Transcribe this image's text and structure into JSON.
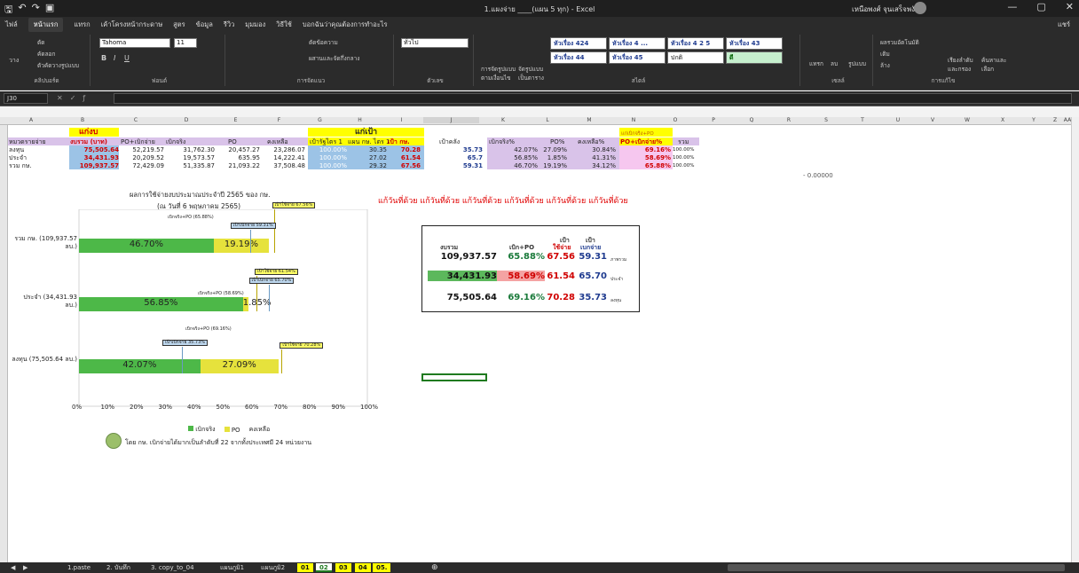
{
  "window": {
    "title": "1.แผงจ่าย ____(แผน 5 ทุก) - Excel",
    "user": "เหนือพงศ์ จุนเสร็จพงันธ์",
    "min": "—",
    "max": "▢",
    "close": "✕"
  },
  "menu": [
    "ไฟล์",
    "หน้าแรก",
    "แทรก",
    "เค้าโครงหน้ากระดาษ",
    "สูตร",
    "ข้อมูล",
    "รีวิว",
    "มุมมอง",
    "วิธีใช้",
    "บอกฉันว่าคุณต้องการทำอะไร"
  ],
  "share": "แชร์",
  "ribbon": {
    "clipboard": {
      "label": "คลิปบอร์ด",
      "paste": "วาง",
      "cut": "ตัด",
      "copy": "คัดลอก",
      "format": "ตัวคัดวางรูปแบบ"
    },
    "font": {
      "label": "ฟอนต์",
      "name": "Tahoma",
      "size": "11",
      "bold": "B",
      "italic": "I",
      "underline": "U"
    },
    "alignment": {
      "label": "การจัดแนว",
      "wrap": "ตัดข้อความ",
      "merge": "ผสานและจัดกึ่งกลาง"
    },
    "number": {
      "label": "ตัวเลข",
      "format": "ทั่วไป"
    },
    "styles": {
      "label": "สไตล์",
      "cond": "การจัดรูปแบบตามเงื่อนไข",
      "table": "จัดรูปแบบเป็นตาราง",
      "items": [
        "หัวเรื่อง 424",
        "หัวเรื่อง 4 ...",
        "หัวเรื่อง 4 2 5",
        "หัวเรื่อง 43",
        "หัวเรื่อง 44",
        "หัวเรื่อง 45",
        "ปกติ",
        "ดี"
      ]
    },
    "cells": {
      "label": "เซลล์",
      "insert": "แทรก",
      "delete": "ลบ",
      "format": "รูปแบบ"
    },
    "editing": {
      "label": "การแก้ไข",
      "autosum": "ผลรวมอัตโนมัติ",
      "fill": "เติม",
      "clear": "ล้าง",
      "sort": "เรียงลำดับและกรอง",
      "find": "ค้นหาและเลือก"
    }
  },
  "formula": {
    "namebox": "J30",
    "content": ""
  },
  "columns": [
    "A",
    "B",
    "C",
    "D",
    "E",
    "F",
    "G",
    "H",
    "I",
    "J",
    "K",
    "L",
    "M",
    "N",
    "O",
    "P",
    "Q",
    "R",
    "S",
    "T",
    "U",
    "V",
    "W",
    "X",
    "Y",
    "Z",
    "AA"
  ],
  "table": {
    "band_budget": "แก่งบ",
    "band_target": "แก่เป้า",
    "n_header": "แก่เบิกจริง+PO",
    "headers": [
      "หมวดรายจ่าย",
      "งบรวม (บาท)",
      "PO+เบิกจ่าย",
      "เบิกจริง",
      "PO",
      "คงเหลือ",
      "เป้ารัฐไตร 1",
      "แผน กษ. ไตร 1",
      "เป้า กษ.",
      "เป้าคลัง",
      "เบิกจริง%",
      "PO%",
      "คงเหลือ%",
      "PO+เบิกจ่าย%",
      "รวม"
    ],
    "rows": [
      {
        "name": "ลงทุน",
        "budget": "75,505.64",
        "po_paid": "52,219.57",
        "paid": "31,762.30",
        "po": "20,457.27",
        "remain": "23,286.07",
        "t1": "100.00%",
        "t2": "30.35",
        "t3": "70.28",
        "t4": "35.73",
        "p1": "42.07%",
        "p2": "27.09%",
        "p3": "30.84%",
        "p4": "69.16%",
        "tot": "100.00%"
      },
      {
        "name": "ประจำ",
        "budget": "34,431.93",
        "po_paid": "20,209.52",
        "paid": "19,573.57",
        "po": "635.95",
        "remain": "14,222.41",
        "t1": "100.00%",
        "t2": "27.02",
        "t3": "61.54",
        "t4": "65.7",
        "p1": "56.85%",
        "p2": "1.85%",
        "p3": "41.31%",
        "p4": "58.69%",
        "tot": "100.00%"
      },
      {
        "name": "รวม กษ.",
        "budget": "109,937.57",
        "po_paid": "72,429.09",
        "paid": "51,335.87",
        "po": "21,093.22",
        "remain": "37,508.48",
        "t1": "100.00%",
        "t2": "29.32",
        "t3": "67.56",
        "t4": "59.31",
        "p1": "46.70%",
        "p2": "19.19%",
        "p3": "34.12%",
        "p4": "65.88%",
        "tot": "100.00%"
      }
    ],
    "stray": "- 0.00000"
  },
  "chart": {
    "title": "ผลการใช้จ่ายงบประมาณประจำปี 2565 ของ กษ.",
    "subtitle": "(ณ วันที่ 6 พฤษภาคม 2565)",
    "legend": [
      "เบิกจริง",
      "PO",
      "คงเหลือ"
    ],
    "footer": "โดย กษ. เบิกจ่ายได้มากเป็นลำดับที่ 22 จากทั้งประเทศมี 24 หน่วยงาน",
    "colors": {
      "paid": "#4db848",
      "po": "#e6e23c",
      "blue_call": "#bdd7ee",
      "yellow_call": "#ffff66"
    }
  },
  "chart_data": {
    "type": "bar",
    "categories": [
      "รวม กษ. (109,937.57 ลบ.)",
      "ประจำ (34,431.93 ลบ.)",
      "ลงทุน (75,505.64 ลบ.)"
    ],
    "series": [
      {
        "name": "เบิกจริง",
        "values": [
          46.7,
          56.85,
          42.07
        ],
        "labels": [
          "46.70%",
          "56.85%",
          "42.07%"
        ]
      },
      {
        "name": "PO",
        "values": [
          19.19,
          1.85,
          27.09
        ],
        "labels": [
          "19.19%",
          "1.85%",
          "27.09%"
        ]
      }
    ],
    "annotations": [
      {
        "cat": 0,
        "blue": "เป้าเบิกจ่าย 59.31%",
        "yellow": "เป้าใช้จ่าย 67.56%",
        "label": "เบิกจริง+PO (65.88%)",
        "bv": 59.31,
        "yv": 67.56
      },
      {
        "cat": 1,
        "blue": "เป้าเบิกจ่าย 65.70%",
        "yellow": "เป้าใช้จ่าย 61.54%",
        "label": "เบิกจริง+PO (58.69%)",
        "bv": 65.7,
        "yv": 61.54
      },
      {
        "cat": 2,
        "blue": "เป้าเบิกจ่าย 35.73%",
        "yellow": "เป้าใช้จ่าย 70.28%",
        "label": "เบิกจริง+PO (69.16%)",
        "bv": 35.73,
        "yv": 70.28
      }
    ],
    "xlim": [
      0,
      100
    ],
    "xticks": [
      "0%",
      "10%",
      "20%",
      "30%",
      "40%",
      "50%",
      "60%",
      "70%",
      "80%",
      "90%",
      "100%"
    ],
    "legend_position": "bottom"
  },
  "banner": "แก้วันที่ด้วย แก้วันที่ด้วย แก้วันที่ด้วย แก้วันที่ด้วย แก้วันที่ด้วย แก้วันที่ด้วย",
  "summary": {
    "h1": "งบรวม",
    "h2": "เบิก+PO",
    "h3a": "เป้า",
    "h3b": "ใช้จ่าย",
    "h4a": "เป้า",
    "h4b": "เบกจ่าย",
    "rows": [
      {
        "budget": "109,937.57",
        "bp": "65.88%",
        "t1": "67.56",
        "t2": "59.31",
        "tag": "ภาพรวม"
      },
      {
        "budget": "34,431.93",
        "bp": "58.69%",
        "t1": "61.54",
        "t2": "65.70",
        "tag": "ประจำ"
      },
      {
        "budget": "75,505.64",
        "bp": "69.16%",
        "t1": "70.28",
        "t2": "35.73",
        "tag": "ลงทุน"
      }
    ]
  },
  "sheets": [
    "1.paste",
    "2. บันทึก",
    "3. copy_to_04",
    "แผนภูมิ1",
    "แผนภูมิ2",
    "01",
    "02",
    "03",
    "04",
    "05."
  ]
}
